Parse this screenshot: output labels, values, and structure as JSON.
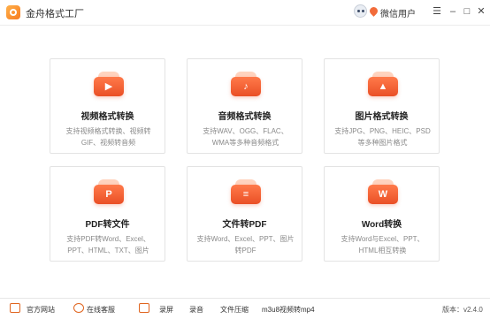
{
  "app": {
    "title": "金舟格式工厂",
    "user_name": "微信用户"
  },
  "window_controls": {
    "menu": "☰",
    "minimize": "–",
    "maximize": "□",
    "close": "✕"
  },
  "cards": [
    {
      "title": "视频格式转换",
      "desc": "支持视频格式转换、视频转GIF、视频转音频",
      "glyph": "▶"
    },
    {
      "title": "音频格式转换",
      "desc": "支持WAV、OGG、FLAC、WMA等多种音频格式",
      "glyph": "♪"
    },
    {
      "title": "图片格式转换",
      "desc": "支持JPG、PNG、HEIC、PSD等多种图片格式",
      "glyph": "▲"
    },
    {
      "title": "PDF转文件",
      "desc": "支持PDF转Word、Excel、PPT、HTML、TXT、图片",
      "glyph": "P"
    },
    {
      "title": "文件转PDF",
      "desc": "支持Word、Excel、PPT、图片转PDF",
      "glyph": "≡"
    },
    {
      "title": "Word转换",
      "desc": "支持Word与Excel、PPT、HTML相互转换",
      "glyph": "W"
    }
  ],
  "footer": {
    "website": "官方网站",
    "service": "在线客服",
    "record": "录屏",
    "audio": "录音",
    "compress": "文件压缩",
    "m3u8": "m3u8视频转mp4",
    "version": "版本：v2.4.0"
  }
}
